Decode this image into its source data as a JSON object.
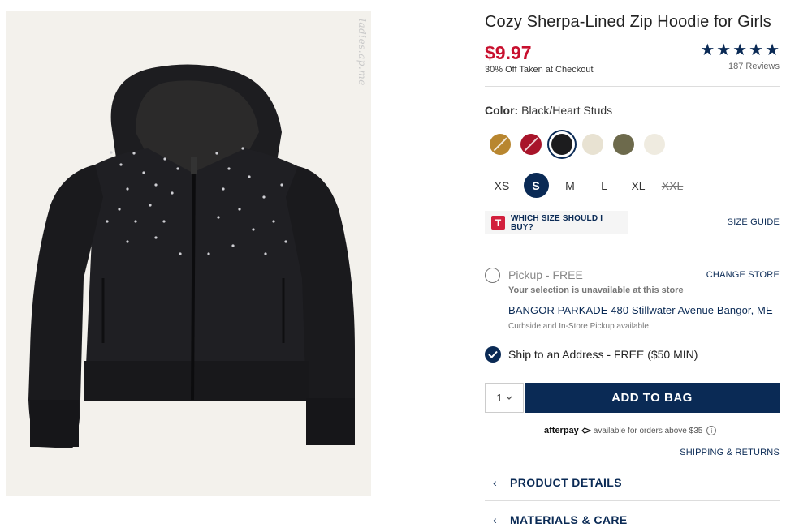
{
  "product": {
    "title": "Cozy Sherpa-Lined Zip Hoodie for Girls",
    "price": "$9.97",
    "discount_note": "30% Off Taken at Checkout",
    "rating_stars": 5,
    "reviews_label": "187 Reviews"
  },
  "watermark": "ladies.ap.me",
  "color": {
    "label": "Color:",
    "value": "Black/Heart Studs",
    "swatches": [
      {
        "name": "tan",
        "hex": "#b8862f",
        "unavailable": true
      },
      {
        "name": "red-plaid",
        "hex": "#a8142a",
        "unavailable": true
      },
      {
        "name": "black-heart-studs",
        "hex": "#1c1c1e",
        "selected": true
      },
      {
        "name": "cream",
        "hex": "#e8e2d2"
      },
      {
        "name": "camo",
        "hex": "#6d6a4c"
      },
      {
        "name": "ivory",
        "hex": "#efebe0"
      }
    ]
  },
  "sizes": [
    {
      "label": "XS"
    },
    {
      "label": "S",
      "selected": true
    },
    {
      "label": "M"
    },
    {
      "label": "L"
    },
    {
      "label": "XL"
    },
    {
      "label": "XXL",
      "unavailable": true
    }
  ],
  "fit": {
    "icon_letter": "T",
    "label": "WHICH SIZE SHOULD I BUY?",
    "size_guide": "SIZE GUIDE"
  },
  "pickup": {
    "label": "Pickup - FREE",
    "change_store": "CHANGE STORE",
    "unavailable_note": "Your selection is unavailable at this store",
    "store": "BANGOR PARKADE 480 Stillwater Avenue  Bangor, ME",
    "curbside_note": "Curbside and In-Store Pickup available"
  },
  "ship": {
    "label": "Ship to an Address - FREE ($50 MIN)"
  },
  "purchase": {
    "quantity": "1",
    "add_to_bag": "ADD TO BAG"
  },
  "afterpay": {
    "logo": "afterpay",
    "note": "available for orders above $35",
    "info": "i"
  },
  "links": {
    "shipping_returns": "SHIPPING & RETURNS"
  },
  "accordions": [
    {
      "label": "PRODUCT DETAILS"
    },
    {
      "label": "MATERIALS & CARE"
    }
  ],
  "colors": {
    "navy": "#0a2a55",
    "price_red": "#c8102e"
  }
}
